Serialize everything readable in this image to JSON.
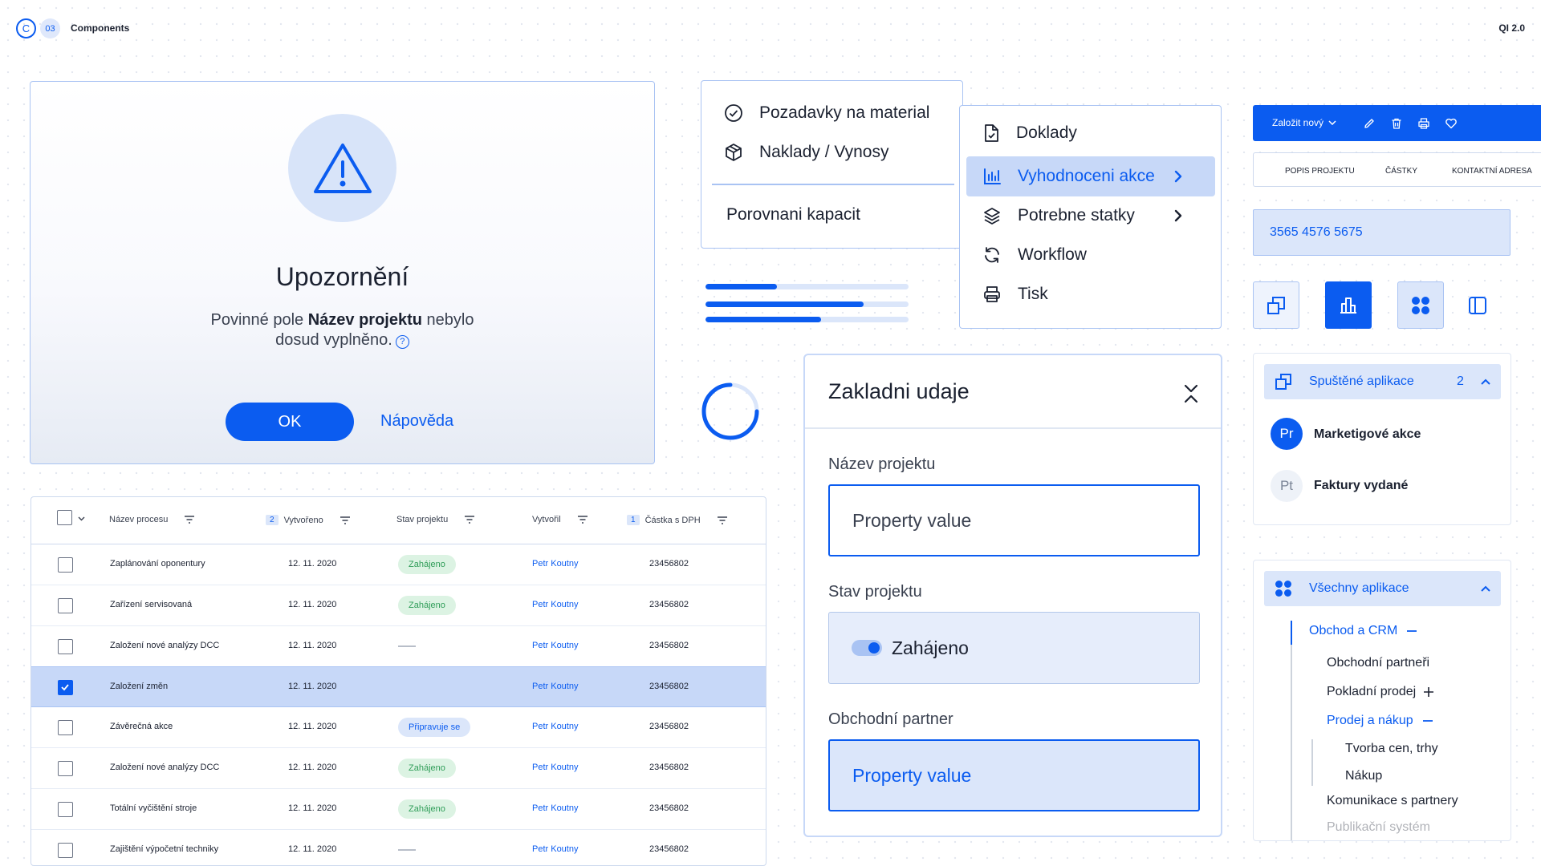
{
  "header": {
    "logo_letter": "C",
    "section_number": "03",
    "title": "Components",
    "version": "QI 2.0"
  },
  "alert": {
    "title": "Upozornění",
    "message_before": "Povinné pole ",
    "message_bold": "Název projektu",
    "message_after": " nebylo",
    "message_line2": "dosud vyplněno.",
    "help_glyph": "?",
    "ok_label": "OK",
    "help_label": "Nápověda"
  },
  "menu1": {
    "items": [
      {
        "label": "Pozadavky na material",
        "icon": "check-circle-icon"
      },
      {
        "label": "Naklady / Vynosy",
        "icon": "box-icon"
      }
    ],
    "footer_item": "Porovnani kapacit"
  },
  "menu2": {
    "items": [
      {
        "label": "Doklady",
        "icon": "document-icon"
      },
      {
        "label": "Vyhodnoceni akce",
        "icon": "bar-chart-icon",
        "active": true
      },
      {
        "label": "Potrebne statky",
        "icon": "layers-icon"
      },
      {
        "label": "Workflow",
        "icon": "refresh-icon"
      },
      {
        "label": "Tisk",
        "icon": "printer-icon"
      }
    ]
  },
  "progress": [
    0.35,
    0.78,
    0.57
  ],
  "table": {
    "headers": {
      "name": "Název procesu",
      "created_badge": "2",
      "created": "Vytvořeno",
      "status": "Stav projektu",
      "author": "Vytvořil",
      "amount_badge": "1",
      "amount": "Částka s DPH"
    },
    "rows": [
      {
        "name": "Zaplánování oponentury",
        "date": "12. 11. 2020",
        "status": "Zahájeno",
        "author": "Petr Koutny",
        "amount": "23456802"
      },
      {
        "name": "Zařízení servisovaná",
        "date": "12. 11. 2020",
        "status": "Zahájeno",
        "author": "Petr Koutny",
        "amount": "23456802"
      },
      {
        "name": "Založení nové analýzy DCC",
        "date": "12. 11. 2020",
        "status": "",
        "author": "Petr Koutny",
        "amount": "23456802"
      },
      {
        "name": "Založení změn",
        "date": "12. 11. 2020",
        "status": "",
        "author": "Petr Koutny",
        "amount": "23456802"
      },
      {
        "name": "Závěrečná akce",
        "date": "12. 11. 2020",
        "status": "Připravuje se",
        "author": "Petr Koutny",
        "amount": "23456802"
      },
      {
        "name": "Založení nové analýzy DCC",
        "date": "12. 11. 2020",
        "status": "Zahájeno",
        "author": "Petr Koutny",
        "amount": "23456802"
      },
      {
        "name": "Totální vyčištění stroje",
        "date": "12. 11. 2020",
        "status": "Zahájeno",
        "author": "Petr Koutny",
        "amount": "23456802"
      },
      {
        "name": "Zajištění výpočetní techniky",
        "date": "12. 11. 2020",
        "status": "",
        "author": "Petr Koutny",
        "amount": "23456802"
      }
    ]
  },
  "panel": {
    "title": "Zakladni udaje",
    "field1_label": "Název projektu",
    "field1_value": "Property value",
    "field2_label": "Stav projektu",
    "field2_value": "Zahájeno",
    "field3_label": "Obchodní partner",
    "field3_value": "Property value"
  },
  "toolbar": {
    "new_label": "Založit nový"
  },
  "tabs": [
    "POPIS PROJEKTU",
    "ČÁSTKY",
    "KONTAKTNÍ ADRESA"
  ],
  "number_field": "3565 4576 5675",
  "running_apps": {
    "title": "Spuštěné aplikace",
    "count": "2",
    "items": [
      {
        "initials": "Pr",
        "label": "Marketigové akce"
      },
      {
        "initials": "Pt",
        "label": "Faktury vydané"
      }
    ]
  },
  "all_apps": {
    "title": "Všechny aplikace",
    "tree": {
      "crm": "Obchod a CRM",
      "partners": "Obchodní partneři",
      "cash_sale": "Pokladní prodej",
      "sales": "Prodej a nákup",
      "pricing": "Tvorba cen, trhy",
      "purchase": "Nákup",
      "communication": "Komunikace s partnery",
      "publishing": "Publikační systém"
    }
  },
  "colors": {
    "accent": "#0b5cf0",
    "accent_light": "#dbe6fa",
    "success_bg": "#dcf3e3",
    "success_text": "#2f9d58"
  }
}
